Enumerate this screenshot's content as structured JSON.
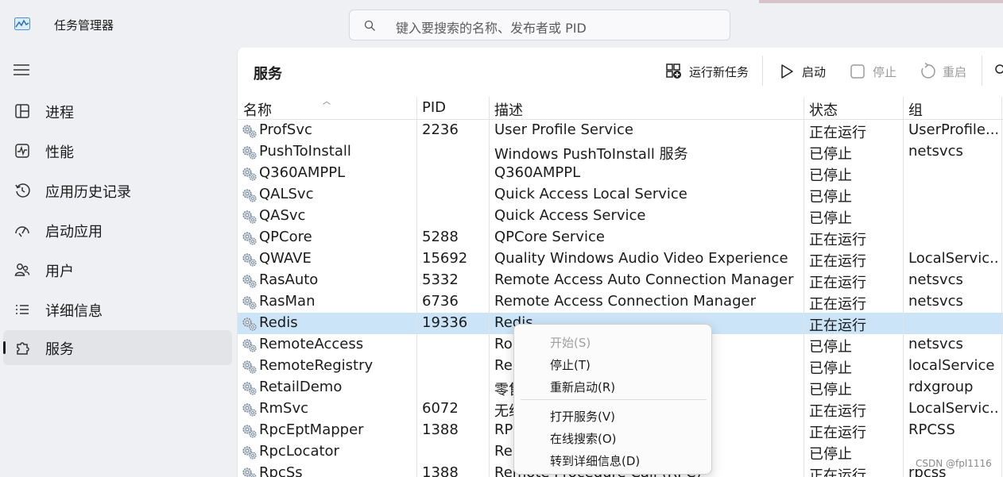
{
  "app": {
    "title": "任务管理器"
  },
  "search": {
    "placeholder": "键入要搜索的名称、发布者或 PID"
  },
  "sidebar": {
    "items": [
      {
        "label": "进程",
        "icon": "grid-icon"
      },
      {
        "label": "性能",
        "icon": "pulse-icon"
      },
      {
        "label": "应用历史记录",
        "icon": "history-icon"
      },
      {
        "label": "启动应用",
        "icon": "speedometer-icon"
      },
      {
        "label": "用户",
        "icon": "users-icon"
      },
      {
        "label": "详细信息",
        "icon": "list-icon"
      },
      {
        "label": "服务",
        "icon": "puzzle-icon",
        "active": true
      }
    ]
  },
  "panel": {
    "title": "服务"
  },
  "toolbar": {
    "run_new_task": "运行新任务",
    "start": "启动",
    "stop": "停止",
    "restart": "重启"
  },
  "table": {
    "columns": [
      "名称",
      "PID",
      "描述",
      "状态",
      "组"
    ],
    "rows": [
      {
        "name": "ProfSvc",
        "pid": "2236",
        "desc": "User Profile Service",
        "status": "正在运行",
        "group": "UserProfile..."
      },
      {
        "name": "PushToInstall",
        "pid": "",
        "desc": "Windows PushToInstall 服务",
        "status": "已停止",
        "group": "netsvcs"
      },
      {
        "name": "Q360AMPPL",
        "pid": "",
        "desc": "Q360AMPPL",
        "status": "已停止",
        "group": ""
      },
      {
        "name": "QALSvc",
        "pid": "",
        "desc": "Quick Access Local Service",
        "status": "已停止",
        "group": ""
      },
      {
        "name": "QASvc",
        "pid": "",
        "desc": "Quick Access Service",
        "status": "已停止",
        "group": ""
      },
      {
        "name": "QPCore",
        "pid": "5288",
        "desc": "QPCore Service",
        "status": "正在运行",
        "group": ""
      },
      {
        "name": "QWAVE",
        "pid": "15692",
        "desc": "Quality Windows Audio Video Experience",
        "status": "正在运行",
        "group": "LocalServic..."
      },
      {
        "name": "RasAuto",
        "pid": "5332",
        "desc": "Remote Access Auto Connection Manager",
        "status": "正在运行",
        "group": "netsvcs"
      },
      {
        "name": "RasMan",
        "pid": "6736",
        "desc": "Remote Access Connection Manager",
        "status": "正在运行",
        "group": "netsvcs"
      },
      {
        "name": "Redis",
        "pid": "19336",
        "desc": "Redis",
        "status": "正在运行",
        "group": "",
        "selected": true
      },
      {
        "name": "RemoteAccess",
        "pid": "",
        "desc": "Rou",
        "status": "已停止",
        "group": "netsvcs"
      },
      {
        "name": "RemoteRegistry",
        "pid": "",
        "desc": "Rer",
        "status": "已停止",
        "group": "localService"
      },
      {
        "name": "RetailDemo",
        "pid": "",
        "desc": "零售",
        "status": "已停止",
        "group": "rdxgroup"
      },
      {
        "name": "RmSvc",
        "pid": "6072",
        "desc": "无线",
        "status": "正在运行",
        "group": "LocalServic..."
      },
      {
        "name": "RpcEptMapper",
        "pid": "1388",
        "desc": "RPC",
        "status": "正在运行",
        "group": "RPCSS"
      },
      {
        "name": "RpcLocator",
        "pid": "",
        "desc": "Rer                                                ator",
        "status": "已停止",
        "group": ""
      },
      {
        "name": "RpcSs",
        "pid": "1388",
        "desc": "Remote Procedure Call (RPC)",
        "status": "正在运行",
        "group": "rpcss"
      }
    ]
  },
  "context_menu": {
    "items": [
      {
        "label": "开始(S)",
        "disabled": true
      },
      {
        "label": "停止(T)"
      },
      {
        "label": "重新启动(R)"
      },
      {
        "label": "打开服务(V)"
      },
      {
        "label": "在线搜索(O)"
      },
      {
        "label": "转到详细信息(D)"
      }
    ]
  },
  "watermark": "CSDN @fpl1116"
}
